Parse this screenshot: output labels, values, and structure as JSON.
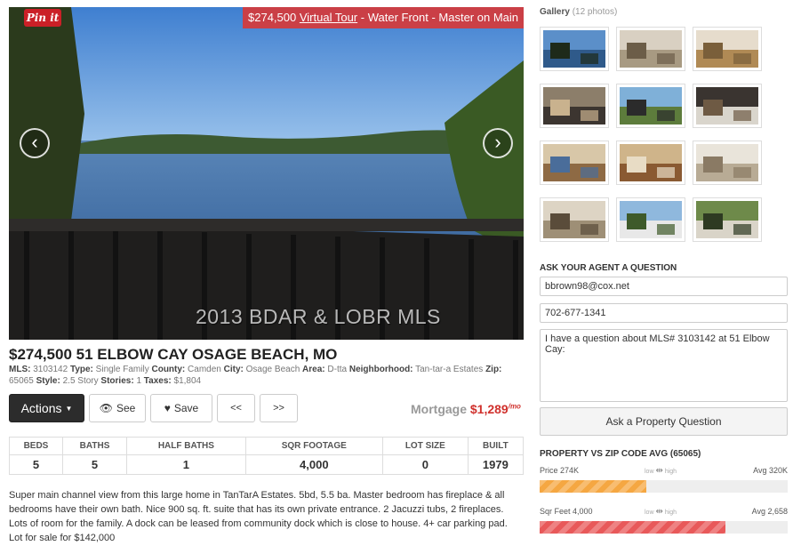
{
  "hero": {
    "pin_label": "Pin it",
    "banner_price": "$274,500",
    "banner_tour": "Virtual Tour",
    "banner_rest": "- Water Front - Master on Main",
    "prev_arrow": "‹",
    "next_arrow": "›",
    "watermark": "2013 BDAR & LOBR MLS"
  },
  "listing": {
    "title": "$274,500 51 ELBOW CAY OSAGE BEACH, MO",
    "meta": [
      {
        "label": "MLS:",
        "value": "3103142"
      },
      {
        "label": "Type:",
        "value": "Single Family"
      },
      {
        "label": "County:",
        "value": "Camden"
      },
      {
        "label": "City:",
        "value": "Osage Beach"
      },
      {
        "label": "Area:",
        "value": "D-tta"
      },
      {
        "label": "Neighborhood:",
        "value": "Tan-tar-a Estates"
      },
      {
        "label": "Zip:",
        "value": "65065"
      },
      {
        "label": "Style:",
        "value": "2.5 Story"
      },
      {
        "label": "Stories:",
        "value": "1"
      },
      {
        "label": "Taxes:",
        "value": "$1,804"
      }
    ],
    "description": "Super main channel view from this large home in TanTarA Estates. 5bd, 5.5 ba. Master bedroom has fireplace & all bedrooms have their own bath. Nice 900 sq. ft. suite that has its own private entrance. 2 Jacuzzi tubs, 2 fireplaces. Lots of room for the family. A dock can be leased from community dock which is close to house. 4+ car parking pad. Lot for sale for $142,000"
  },
  "toolbar": {
    "actions_label": "Actions",
    "see_label": "See",
    "save_label": "Save",
    "prev_label": "<<",
    "next_label": ">>",
    "mortgage_label": "Mortgage",
    "mortgage_amount": "$1,289",
    "mortgage_unit": "/mo"
  },
  "facts": {
    "headers": [
      "BEDS",
      "BATHS",
      "HALF BATHS",
      "SQR FOOTAGE",
      "LOT SIZE",
      "BUILT"
    ],
    "values": [
      "5",
      "5",
      "1",
      "4,000",
      "0",
      "1979"
    ]
  },
  "gallery": {
    "title": "Gallery",
    "count": "(12 photos)",
    "thumbs": [
      "lake-view",
      "living-room",
      "dining-room",
      "fireplace-room",
      "deck-view",
      "bedroom",
      "twin-bedroom",
      "bedroom-2",
      "bathroom",
      "great-room",
      "house-exterior",
      "house-front"
    ]
  },
  "agent": {
    "heading": "ASK YOUR AGENT A QUESTION",
    "email": "bbrown98@cox.net",
    "phone": "702-677-1341",
    "message": "I have a question about MLS# 3103142 at 51 Elbow Cay:",
    "button": "Ask a Property Question"
  },
  "compare": {
    "heading": "PROPERTY VS ZIP CODE AVG (65065)",
    "low_label": "low",
    "high_label": "high",
    "rows": [
      {
        "label": "Price 274K",
        "avg": "Avg 320K",
        "fraction": 0.43,
        "color": "#f5a742"
      },
      {
        "label": "Sqr Feet 4,000",
        "avg": "Avg 2,658",
        "fraction": 0.75,
        "color": "#e8595a"
      }
    ]
  },
  "colors": {
    "accent_red": "#d0312d",
    "pin_red": "#cb2027",
    "banner_red": "#d63a3a",
    "dark_button": "#2c2c2c"
  }
}
